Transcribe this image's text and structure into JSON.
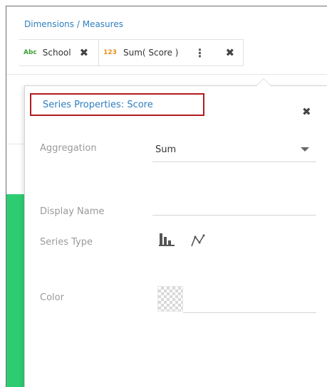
{
  "dimensions_measures": {
    "title": "Dimensions / Measures",
    "fields": [
      {
        "type_badge": "Abc",
        "label": "School"
      },
      {
        "type_badge": "123",
        "label": "Sum( Score )"
      }
    ]
  },
  "series_properties": {
    "title": "Series Properties: Score",
    "aggregation_label": "Aggregation",
    "aggregation_value": "Sum",
    "display_name_label": "Display Name",
    "display_name_value": "",
    "series_type_label": "Series Type",
    "series_type_options": [
      "bar-chart-icon",
      "line-chart-icon"
    ],
    "color_label": "Color"
  },
  "colors": {
    "accent_text": "#2f7fbf",
    "highlight_border": "#b01c1c",
    "dimension_badge": "#3aa13a",
    "measure_badge": "#f08c1a",
    "chart_bar": "#2ecc71"
  }
}
